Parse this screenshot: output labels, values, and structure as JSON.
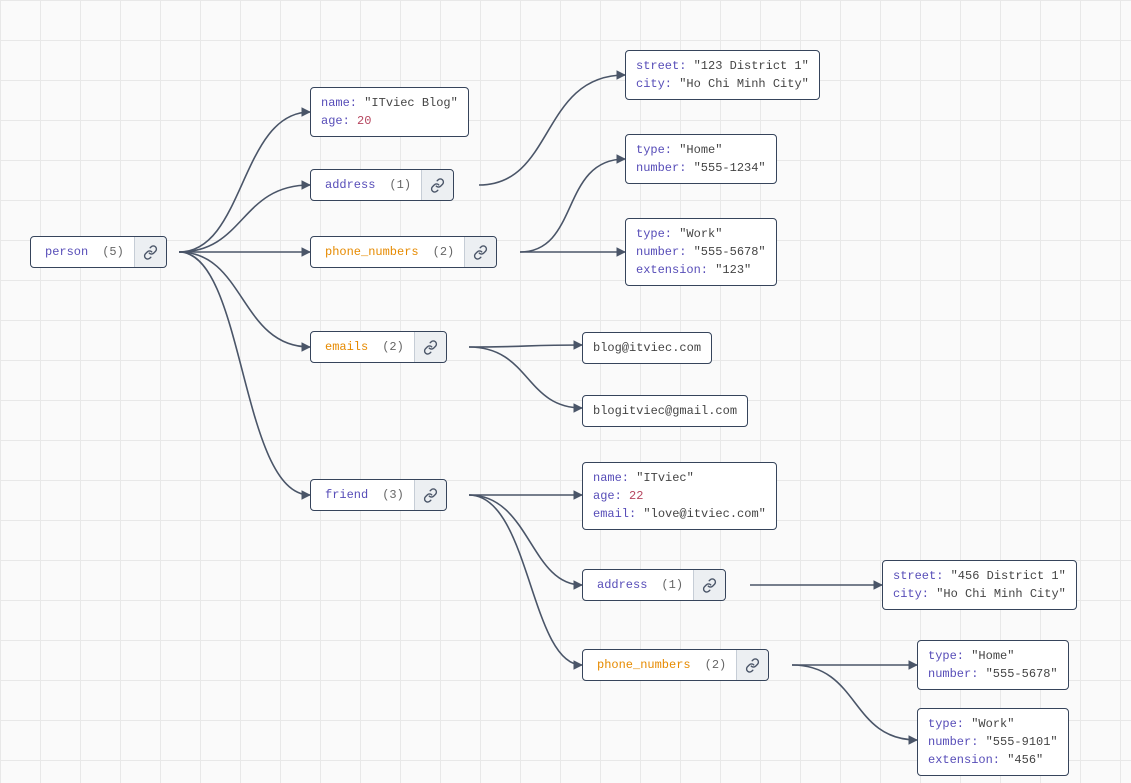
{
  "nodes": {
    "person": {
      "label": "person",
      "count": "(5)"
    },
    "address": {
      "label": "address",
      "count": "(1)"
    },
    "phone_numbers": {
      "label": "phone_numbers",
      "count": "(2)"
    },
    "emails": {
      "label": "emails",
      "count": "(2)"
    },
    "friend": {
      "label": "friend",
      "count": "(3)"
    },
    "friend_address": {
      "label": "address",
      "count": "(1)"
    },
    "friend_phone_numbers": {
      "label": "phone_numbers",
      "count": "(2)"
    }
  },
  "leaves": {
    "person_props": [
      {
        "key": "name",
        "type": "s",
        "value": "\"ITviec Blog\""
      },
      {
        "key": "age",
        "type": "n",
        "value": "20"
      }
    ],
    "address_props": [
      {
        "key": "street",
        "type": "s",
        "value": "\"123 District 1\""
      },
      {
        "key": "city",
        "type": "s",
        "value": "\"Ho Chi Minh City\""
      }
    ],
    "phone0": [
      {
        "key": "type",
        "type": "s",
        "value": "\"Home\""
      },
      {
        "key": "number",
        "type": "s",
        "value": "\"555-1234\""
      }
    ],
    "phone1": [
      {
        "key": "type",
        "type": "s",
        "value": "\"Work\""
      },
      {
        "key": "number",
        "type": "s",
        "value": "\"555-5678\""
      },
      {
        "key": "extension",
        "type": "s",
        "value": "\"123\""
      }
    ],
    "email0": {
      "value": "blog@itviec.com"
    },
    "email1": {
      "value": "blogitviec@gmail.com"
    },
    "friend_props": [
      {
        "key": "name",
        "type": "s",
        "value": "\"ITviec\""
      },
      {
        "key": "age",
        "type": "n",
        "value": "22"
      },
      {
        "key": "email",
        "type": "s",
        "value": "\"love@itviec.com\""
      }
    ],
    "friend_address_props": [
      {
        "key": "street",
        "type": "s",
        "value": "\"456 District 1\""
      },
      {
        "key": "city",
        "type": "s",
        "value": "\"Ho Chi Minh City\""
      }
    ],
    "fphone0": [
      {
        "key": "type",
        "type": "s",
        "value": "\"Home\""
      },
      {
        "key": "number",
        "type": "s",
        "value": "\"555-5678\""
      }
    ],
    "fphone1": [
      {
        "key": "type",
        "type": "s",
        "value": "\"Work\""
      },
      {
        "key": "number",
        "type": "s",
        "value": "\"555-9101\""
      },
      {
        "key": "extension",
        "type": "s",
        "value": "\"456\""
      }
    ]
  },
  "icons": {
    "link": "link-icon"
  },
  "colors": {
    "edge": "#4a5568"
  }
}
